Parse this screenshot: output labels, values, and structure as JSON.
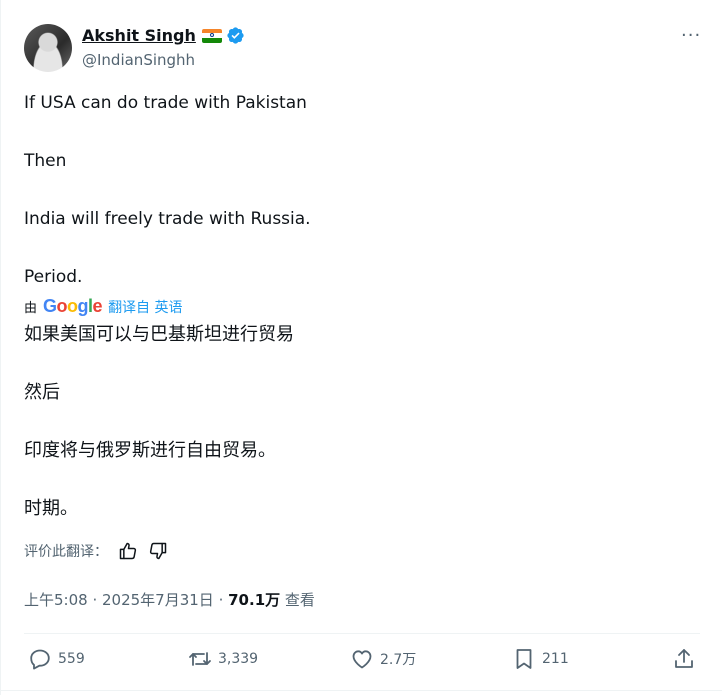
{
  "author": {
    "name": "Akshit Singh",
    "handle": "@IndianSinghh"
  },
  "tweet": {
    "lines": [
      "If USA can do trade with Pakistan",
      "Then",
      "India will freely trade with Russia.",
      "Period."
    ]
  },
  "translation": {
    "by_label": "由",
    "google_letters": [
      "G",
      "o",
      "o",
      "g",
      "l",
      "e"
    ],
    "translated_from": "翻译自 英语",
    "lines": [
      "如果美国可以与巴基斯坦进行贸易",
      "然后",
      "印度将与俄罗斯进行自由贸易。",
      "时期。"
    ],
    "rate_label": "评价此翻译："
  },
  "meta": {
    "time": "上午5:08",
    "sep1": " · ",
    "date": "2025年7月31日",
    "sep2": " · ",
    "views": "70.1万",
    "views_label": " 查看"
  },
  "actions": {
    "replies": "559",
    "retweets": "3,339",
    "likes": "2.7万",
    "bookmarks": "211"
  },
  "more_label": "···",
  "colors": {
    "accent": "#1d9bf0",
    "text": "#0f1419",
    "secondary": "#536471"
  },
  "icons": [
    "verified-icon",
    "india-flag-icon",
    "more-icon",
    "thumbs-up-icon",
    "thumbs-down-icon",
    "reply-icon",
    "retweet-icon",
    "like-icon",
    "bookmark-icon",
    "share-icon"
  ]
}
